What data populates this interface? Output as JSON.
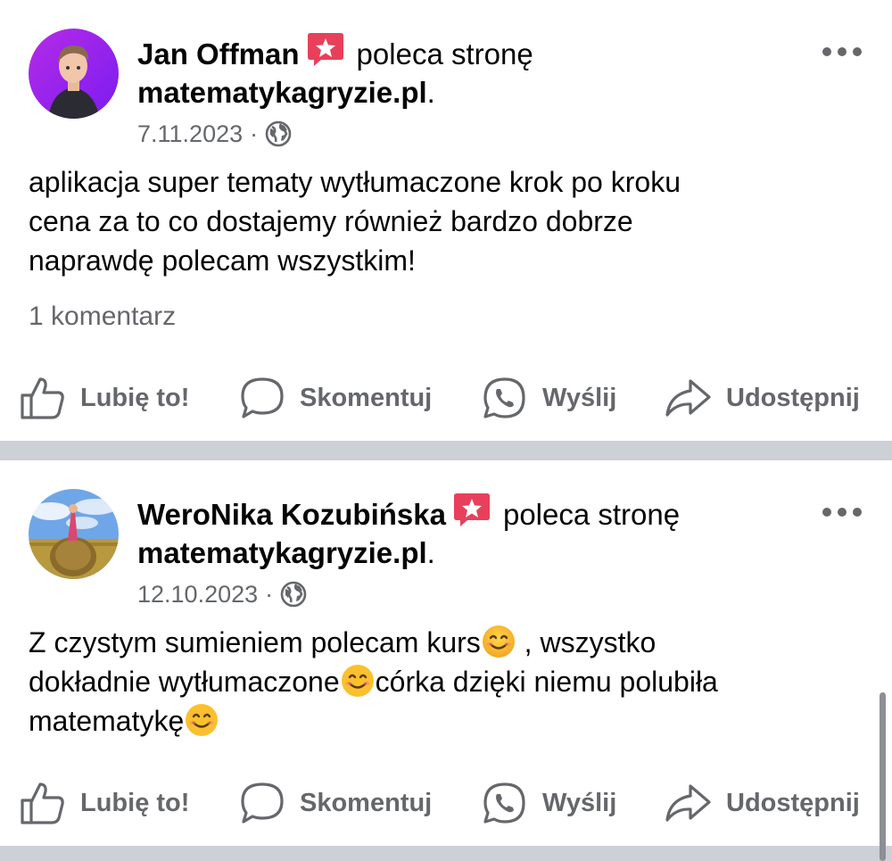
{
  "posts": [
    {
      "author": "Jan Offman",
      "verb": "poleca stronę",
      "page": "matematykagryzie.pl",
      "page_suffix": ".",
      "date": "7.11.2023",
      "separator": "·",
      "visibility_icon": "globe-icon",
      "text_lines": [
        "aplikacja super tematy wytłumaczone krok po kroku",
        "cena za to co dostajemy również bardzo dobrze",
        "naprawdę polecam wszystkim!"
      ],
      "comments": "1 komentarz"
    },
    {
      "author": "WeroNika Kozubińska",
      "verb": "poleca stronę",
      "page": "matematykagryzie.pl",
      "page_suffix": ".",
      "date": "12.10.2023",
      "separator": "·",
      "visibility_icon": "globe-icon",
      "text_segments": [
        "Z czystym sumieniem polecam kurs",
        " , wszystko",
        "dokładnie wytłumaczone",
        "córka dzięki niemu polubiła",
        "matematykę"
      ]
    }
  ],
  "actions": {
    "like": "Lubię to!",
    "comment": "Skomentuj",
    "send": "Wyślij",
    "share": "Udostępnij"
  },
  "colors": {
    "recommend_badge": "#e8405a",
    "secondary_text": "#65676b",
    "separator": "#cdd0d6"
  }
}
